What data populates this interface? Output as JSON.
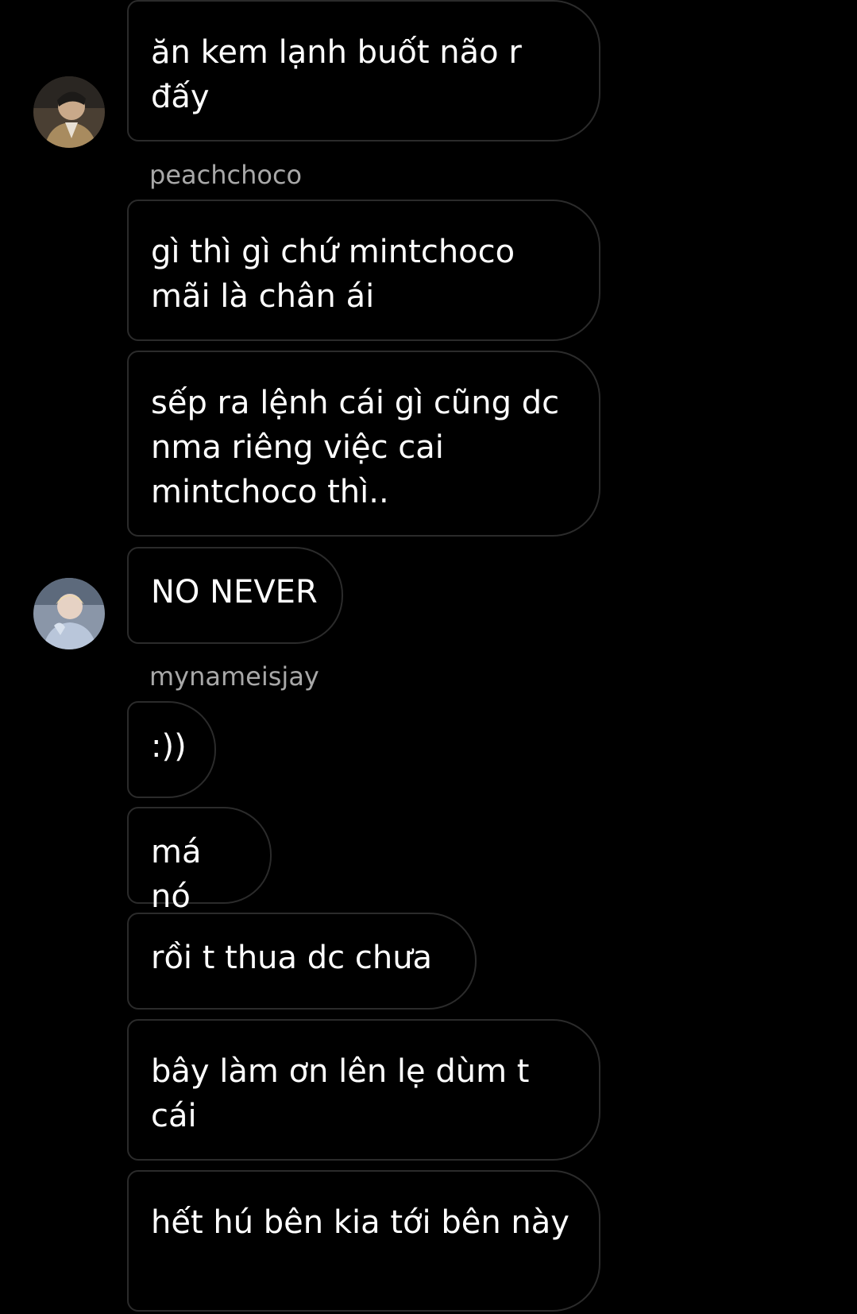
{
  "theme": {
    "background": "#000000",
    "bubble_border": "#2b2b2b",
    "text": "#ffffff",
    "username_text": "#a8a8a8"
  },
  "chat": {
    "groups": [
      {
        "username": "peachchoco",
        "avatar_icon": "user-avatar-icon",
        "messages": [
          "ăn kem lạnh buốt não r đấy"
        ]
      },
      {
        "username": "mynameisjay",
        "avatar_icon": "user-avatar-icon",
        "messages": [
          "gì thì gì chứ mintchoco mãi là chân ái",
          "sếp ra lệnh cái gì cũng dc nma riêng việc cai mintchoco thì..",
          "NO NEVER"
        ]
      },
      {
        "username": "",
        "avatar_icon": "",
        "messages": [
          ":))",
          "má nó",
          "rồi t thua dc chưa",
          "bây làm ơn lên lẹ dùm t cái",
          "hết hú bên kia tới bên này"
        ]
      }
    ]
  }
}
